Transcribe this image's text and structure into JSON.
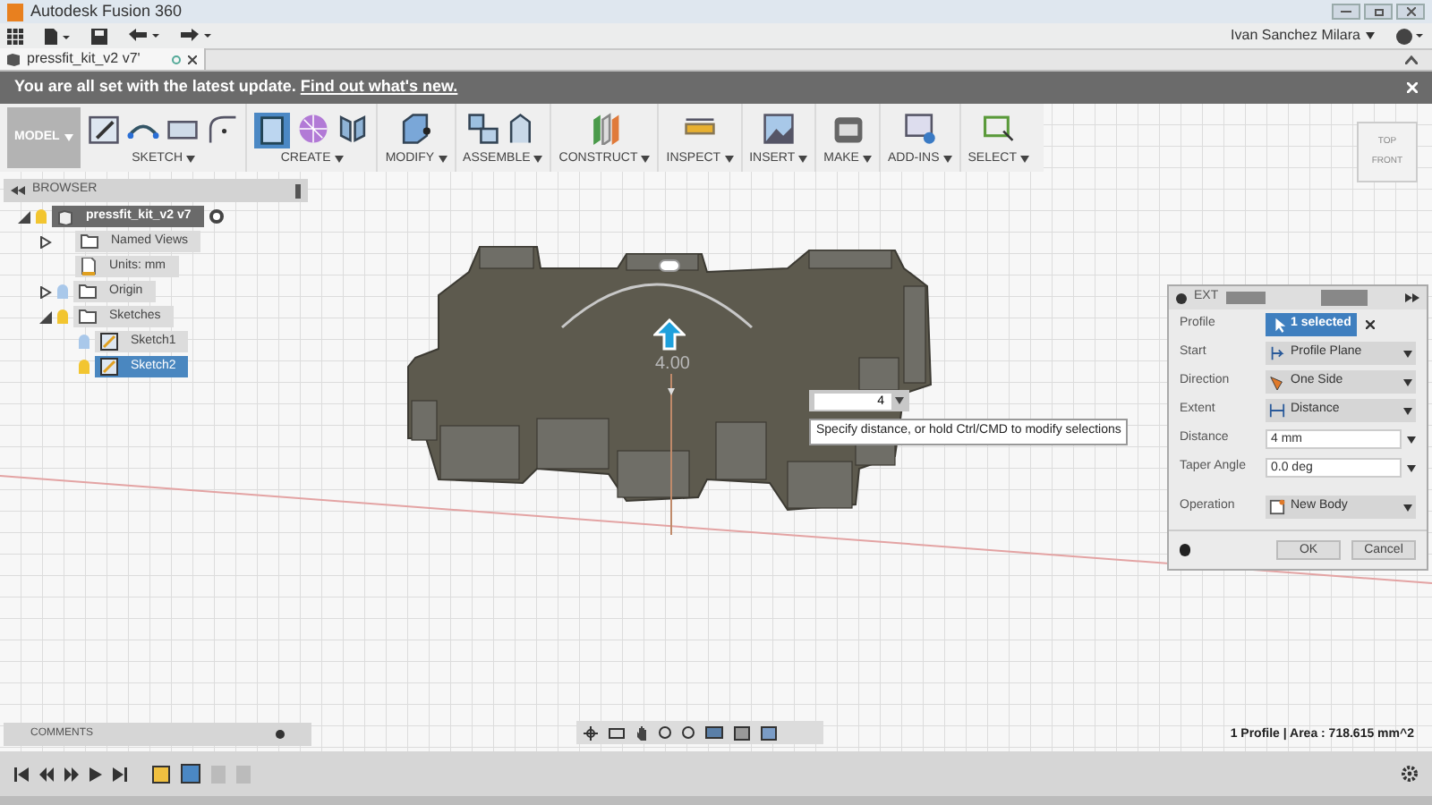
{
  "window": {
    "title": "Autodesk Fusion 360"
  },
  "account": {
    "user": "Ivan Sanchez Milara"
  },
  "document_tab": {
    "title": "pressfit_kit_v2 v7'",
    "selected": true
  },
  "notification": {
    "message": "You are all set with the latest update.",
    "link": "Find out what's new."
  },
  "ribbon": {
    "workspace": "MODEL",
    "groups": [
      {
        "label": "SKETCH",
        "kind": "sketch"
      },
      {
        "label": "CREATE",
        "kind": "create"
      },
      {
        "label": "MODIFY",
        "kind": "modify"
      },
      {
        "label": "ASSEMBLE",
        "kind": "assemble"
      },
      {
        "label": "CONSTRUCT",
        "kind": "construct"
      },
      {
        "label": "INSPECT",
        "kind": "inspect"
      },
      {
        "label": "INSERT",
        "kind": "insert"
      },
      {
        "label": "MAKE",
        "kind": "make"
      },
      {
        "label": "ADD-INS",
        "kind": "addins"
      },
      {
        "label": "SELECT",
        "kind": "select"
      }
    ]
  },
  "browser": {
    "title": "BROWSER",
    "tree": [
      {
        "label": "pressfit_kit_v2 v7",
        "kind": "component",
        "visible": true,
        "expanded": true,
        "selected": false,
        "children": [
          {
            "label": "Named Views",
            "kind": "views",
            "expanded": false,
            "selected": false
          },
          {
            "label": "Units: mm",
            "kind": "units",
            "selected": false
          },
          {
            "label": "Origin",
            "kind": "folder",
            "visible": false,
            "expanded": false,
            "selected": false
          },
          {
            "label": "Sketches",
            "kind": "folder",
            "visible": true,
            "expanded": true,
            "selected": false,
            "children": [
              {
                "label": "Sketch1",
                "kind": "sketch",
                "visible": false,
                "selected": false
              },
              {
                "label": "Sketch2",
                "kind": "sketch",
                "visible": true,
                "selected": true
              }
            ]
          }
        ]
      }
    ]
  },
  "viewport": {
    "dimension": "4.00",
    "distance_input": {
      "value": "4"
    },
    "tooltip": "Specify distance, or hold Ctrl/CMD to modify selections",
    "view_cube": {
      "top": "TOP",
      "front": "FRONT"
    }
  },
  "extrude": {
    "title": "EXT",
    "rows": [
      {
        "label": "Profile",
        "kind": "selection",
        "value": "1 selected"
      },
      {
        "label": "Start",
        "kind": "dropdown",
        "value": "Profile Plane"
      },
      {
        "label": "Direction",
        "kind": "dropdown",
        "value": "One Side"
      },
      {
        "label": "Extent",
        "kind": "dropdown",
        "value": "Distance"
      },
      {
        "label": "Distance",
        "kind": "input",
        "value": "4 mm"
      },
      {
        "label": "Taper Angle",
        "kind": "input",
        "value": "0.0 deg"
      },
      {
        "label": "Operation",
        "kind": "dropdown",
        "value": "New Body"
      }
    ],
    "buttons": [
      "OK",
      "Cancel"
    ]
  },
  "comments": {
    "title": "COMMENTS"
  },
  "status": "1 Profile | Area : 718.615 mm^2"
}
